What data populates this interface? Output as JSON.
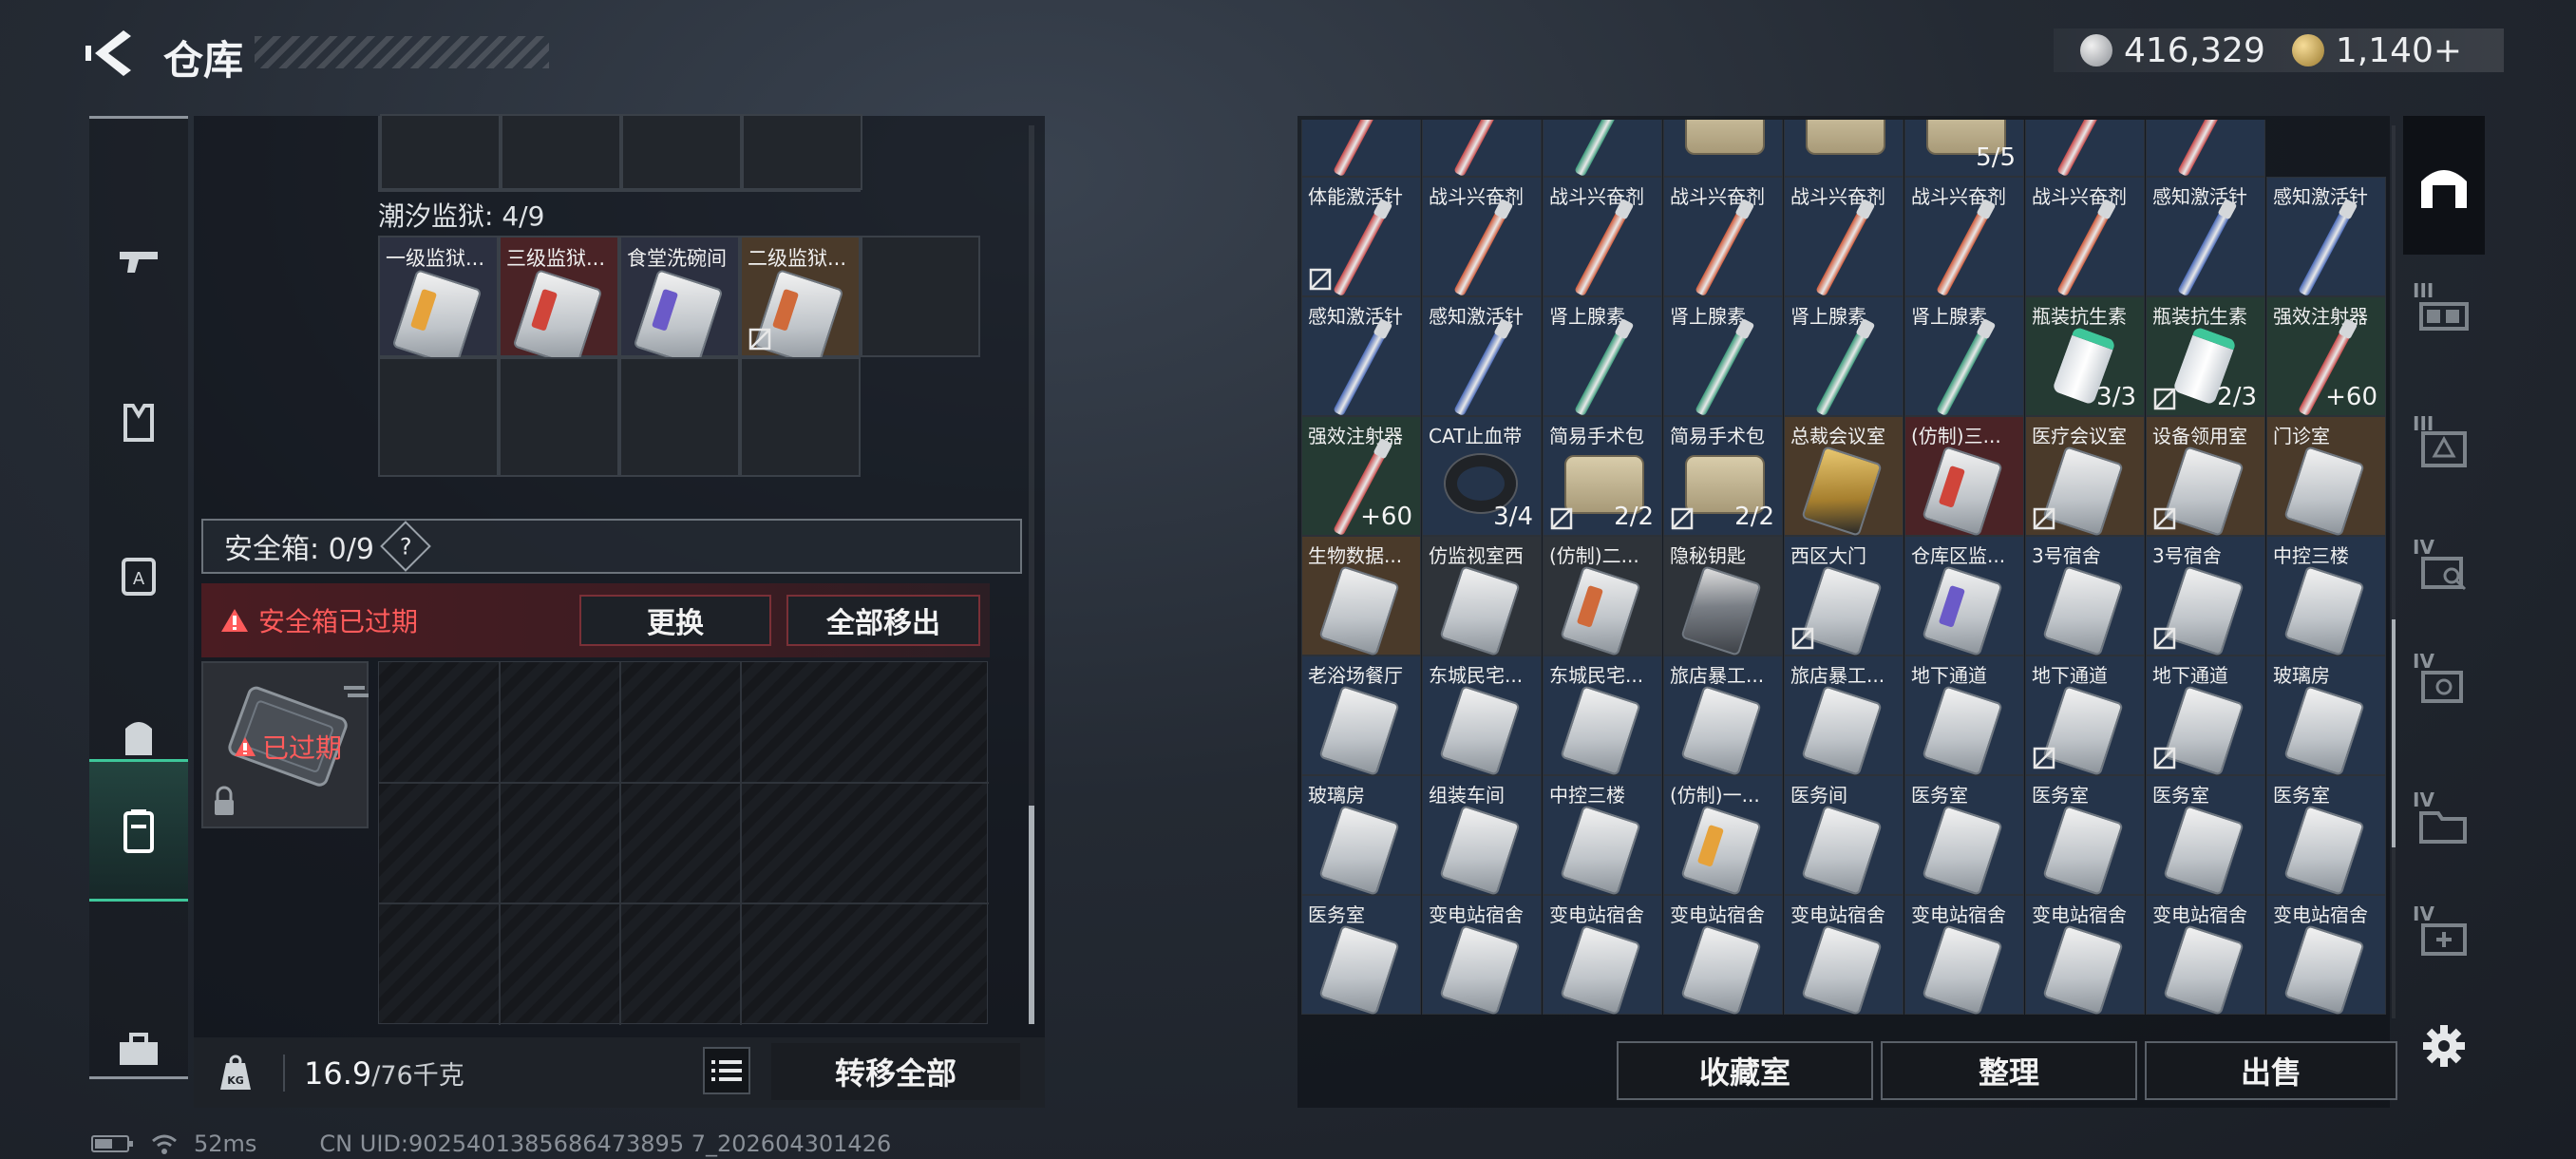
{
  "header": {
    "title": "仓库"
  },
  "currency": [
    {
      "icon": "silver-coin-icon",
      "value": "416,329"
    },
    {
      "icon": "gold-coin-icon",
      "value": "1,140+"
    }
  ],
  "left_nav": {
    "items": [
      {
        "name": "weapon",
        "icon": "gun-icon"
      },
      {
        "name": "vest",
        "icon": "vest-icon"
      },
      {
        "name": "armor",
        "icon": "armor-icon"
      },
      {
        "name": "backpack",
        "icon": "backpack-icon"
      },
      {
        "name": "safe-box",
        "icon": "safe-box-icon",
        "active": true
      },
      {
        "name": "toolbox",
        "icon": "toolbox-icon"
      }
    ]
  },
  "container": {
    "name": "潮汐监狱: 4/9",
    "items": [
      {
        "label": "一级监狱...",
        "bg": "#2c3040",
        "stripe": "#e6a23a"
      },
      {
        "label": "三级监狱...",
        "bg": "#4a2326",
        "stripe": "#d0453a"
      },
      {
        "label": "食堂洗碗间",
        "bg": "#2c3040",
        "stripe": "#6b5ac8"
      },
      {
        "label": "二级监狱...",
        "bg": "#4a3a2a",
        "stripe": "#d06a3a",
        "icon": "no-trade"
      }
    ]
  },
  "safe_box": {
    "title": "安全箱: 0/9",
    "help": "?",
    "expired_notice": "安全箱已过期",
    "replace_label": "更换",
    "remove_all_label": "全部移出",
    "item_status": "已过期"
  },
  "bottom_left": {
    "weight_current": "16.9",
    "weight_total": "/76千克",
    "kg_icon": "KG",
    "transfer_all_label": "转移全部"
  },
  "storage_grid": {
    "rows": [
      [
        {
          "label": "",
          "bg": "navy",
          "kind": "syringe",
          "color": "#c84848"
        },
        {
          "label": "",
          "bg": "navy",
          "kind": "syringe",
          "color": "#c84848"
        },
        {
          "label": "",
          "bg": "navy",
          "kind": "syringe",
          "color": "#3a9a7a"
        },
        {
          "label": "",
          "bg": "navy",
          "kind": "pouch"
        },
        {
          "label": "",
          "bg": "navy",
          "kind": "pouch"
        },
        {
          "label": "",
          "bg": "navy",
          "kind": "pouch",
          "count": "5/5"
        },
        {
          "label": "",
          "bg": "navy",
          "kind": "syringe",
          "color": "#c84848"
        },
        {
          "label": "",
          "bg": "navy",
          "kind": "syringe",
          "color": "#c84848"
        }
      ],
      [
        {
          "label": "体能激活针",
          "bg": "navy",
          "kind": "syringe",
          "color": "#c84848",
          "icon": "no-trade"
        },
        {
          "label": "战斗兴奋剂",
          "bg": "navy",
          "kind": "syringe",
          "color": "#d05a3a"
        },
        {
          "label": "战斗兴奋剂",
          "bg": "navy",
          "kind": "syringe",
          "color": "#d05a3a"
        },
        {
          "label": "战斗兴奋剂",
          "bg": "navy",
          "kind": "syringe",
          "color": "#d05a3a"
        },
        {
          "label": "战斗兴奋剂",
          "bg": "navy",
          "kind": "syringe",
          "color": "#d05a3a"
        },
        {
          "label": "战斗兴奋剂",
          "bg": "navy",
          "kind": "syringe",
          "color": "#d05a3a"
        },
        {
          "label": "战斗兴奋剂",
          "bg": "navy",
          "kind": "syringe",
          "color": "#d05a3a"
        },
        {
          "label": "感知激活针",
          "bg": "navy",
          "kind": "syringe",
          "color": "#4a6ab8"
        },
        {
          "label": "感知激活针",
          "bg": "navy",
          "kind": "syringe",
          "color": "#4a6ab8"
        }
      ],
      [
        {
          "label": "感知激活针",
          "bg": "navy",
          "kind": "syringe",
          "color": "#4a6ab8"
        },
        {
          "label": "感知激活针",
          "bg": "navy",
          "kind": "syringe",
          "color": "#4a6ab8"
        },
        {
          "label": "肾上腺素",
          "bg": "navy",
          "kind": "syringe",
          "color": "#3a9a7a"
        },
        {
          "label": "肾上腺素",
          "bg": "navy",
          "kind": "syringe",
          "color": "#3a9a7a"
        },
        {
          "label": "肾上腺素",
          "bg": "navy",
          "kind": "syringe",
          "color": "#3a9a7a"
        },
        {
          "label": "肾上腺素",
          "bg": "navy",
          "kind": "syringe",
          "color": "#3a9a7a"
        },
        {
          "label": "瓶装抗生素",
          "bg": "green",
          "kind": "bottle",
          "count": "3/3"
        },
        {
          "label": "瓶装抗生素",
          "bg": "green",
          "kind": "bottle",
          "count": "2/3",
          "icon": "no-trade"
        },
        {
          "label": "强效注射器",
          "bg": "green",
          "kind": "syringe",
          "color": "#c84848",
          "count": "+60"
        }
      ],
      [
        {
          "label": "强效注射器",
          "bg": "green",
          "kind": "syringe",
          "color": "#c84848",
          "count": "+60"
        },
        {
          "label": "CAT止血带",
          "bg": "navy",
          "kind": "tourniquet",
          "count": "3/4"
        },
        {
          "label": "简易手术包",
          "bg": "navy",
          "kind": "pouch",
          "count": "2/2",
          "icon": "no-trade"
        },
        {
          "label": "简易手术包",
          "bg": "navy",
          "kind": "pouch",
          "count": "2/2",
          "icon": "no-trade"
        },
        {
          "label": "总裁会议室",
          "bg": "brown",
          "kind": "card-gold"
        },
        {
          "label": "(仿制)三...",
          "bg": "red",
          "kind": "card",
          "stripe": "#d0453a"
        },
        {
          "label": "医疗会议室",
          "bg": "brown",
          "kind": "card",
          "icon": "no-trade"
        },
        {
          "label": "设备领用室",
          "bg": "brown",
          "kind": "card",
          "icon": "no-trade"
        },
        {
          "label": "门诊室",
          "bg": "brown",
          "kind": "card"
        }
      ],
      [
        {
          "label": "生物数据...",
          "bg": "brown",
          "kind": "card"
        },
        {
          "label": "仿监视室西",
          "bg": "gray",
          "kind": "card"
        },
        {
          "label": "(仿制)二...",
          "bg": "gray",
          "kind": "card",
          "stripe": "#d06a3a"
        },
        {
          "label": "隐秘钥匙",
          "bg": "gray",
          "kind": "card-dark"
        },
        {
          "label": "西区大门",
          "bg": "navy",
          "kind": "card",
          "icon": "no-trade"
        },
        {
          "label": "仓库区监...",
          "bg": "navy",
          "kind": "card",
          "stripe": "#6b5ac8"
        },
        {
          "label": "3号宿舍",
          "bg": "navy",
          "kind": "card"
        },
        {
          "label": "3号宿舍",
          "bg": "navy",
          "kind": "card",
          "icon": "no-trade"
        },
        {
          "label": "中控三楼",
          "bg": "navy",
          "kind": "card"
        }
      ],
      [
        {
          "label": "老浴场餐厅",
          "bg": "navy",
          "kind": "card"
        },
        {
          "label": "东城民宅...",
          "bg": "navy",
          "kind": "card"
        },
        {
          "label": "东城民宅...",
          "bg": "navy",
          "kind": "card"
        },
        {
          "label": "旅店暴工...",
          "bg": "navy",
          "kind": "card"
        },
        {
          "label": "旅店暴工...",
          "bg": "navy",
          "kind": "card"
        },
        {
          "label": "地下通道",
          "bg": "navy",
          "kind": "card"
        },
        {
          "label": "地下通道",
          "bg": "navy",
          "kind": "card",
          "icon": "no-trade"
        },
        {
          "label": "地下通道",
          "bg": "navy",
          "kind": "card",
          "icon": "no-trade"
        },
        {
          "label": "玻璃房",
          "bg": "navy",
          "kind": "card"
        }
      ],
      [
        {
          "label": "玻璃房",
          "bg": "navy",
          "kind": "card"
        },
        {
          "label": "组装车间",
          "bg": "navy",
          "kind": "card"
        },
        {
          "label": "中控三楼",
          "bg": "navy",
          "kind": "card"
        },
        {
          "label": "(仿制)一...",
          "bg": "navy",
          "kind": "card",
          "stripe": "#e6a23a"
        },
        {
          "label": "医务间",
          "bg": "navy",
          "kind": "card"
        },
        {
          "label": "医务室",
          "bg": "navy",
          "kind": "card"
        },
        {
          "label": "医务室",
          "bg": "navy",
          "kind": "card"
        },
        {
          "label": "医务室",
          "bg": "navy",
          "kind": "card"
        },
        {
          "label": "医务室",
          "bg": "navy",
          "kind": "card"
        }
      ],
      [
        {
          "label": "医务室",
          "bg": "navy",
          "kind": "card"
        },
        {
          "label": "变电站宿舍",
          "bg": "navy",
          "kind": "card"
        },
        {
          "label": "变电站宿舍",
          "bg": "navy",
          "kind": "card"
        },
        {
          "label": "变电站宿舍",
          "bg": "navy",
          "kind": "card"
        },
        {
          "label": "变电站宿舍",
          "bg": "navy",
          "kind": "card"
        },
        {
          "label": "变电站宿舍",
          "bg": "navy",
          "kind": "card"
        },
        {
          "label": "变电站宿舍",
          "bg": "navy",
          "kind": "card"
        },
        {
          "label": "变电站宿舍",
          "bg": "navy",
          "kind": "card"
        },
        {
          "label": "变电站宿舍",
          "bg": "navy",
          "kind": "card"
        }
      ]
    ]
  },
  "right_actions": {
    "collection_label": "收藏室",
    "organize_label": "整理",
    "sell_label": "出售"
  },
  "right_nav": {
    "items": [
      {
        "name": "warehouse",
        "tier": "",
        "active": true
      },
      {
        "name": "storage-3",
        "tier": "III"
      },
      {
        "name": "storage-3b",
        "tier": "III"
      },
      {
        "name": "storage-4a",
        "tier": "IV"
      },
      {
        "name": "storage-4b",
        "tier": "IV"
      },
      {
        "name": "storage-4c",
        "tier": "IV"
      },
      {
        "name": "storage-4d",
        "tier": "IV"
      }
    ]
  },
  "status": {
    "ping": "52ms",
    "uid": "CN UID:9025401385686473895 7_202604301426"
  },
  "colors": {
    "accent_green": "#3ec79a",
    "warning_red": "#ff5b5b",
    "navy_bg": "#25344a"
  }
}
